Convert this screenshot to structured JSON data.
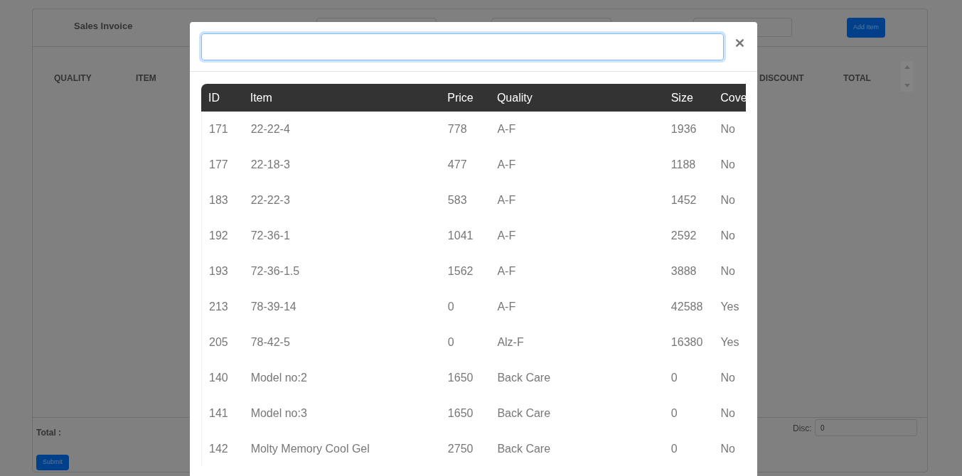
{
  "invoice": {
    "title": "Sales Invoice",
    "add_button": "Add Item",
    "columns": [
      "QUALITY",
      "ITEM",
      "DISCOUNT",
      "TOTAL"
    ],
    "total_label": "Total :",
    "disc_label": "Disc:",
    "disc_value": "0",
    "submit": "Submit"
  },
  "modal": {
    "columns": [
      "ID",
      "Item",
      "Price",
      "Quality",
      "Size",
      "Cove"
    ],
    "rows": [
      [
        "171",
        "22-22-4",
        "778",
        "A-F",
        "1936",
        "No"
      ],
      [
        "177",
        "22-18-3",
        "477",
        "A-F",
        "1188",
        "No"
      ],
      [
        "183",
        "22-22-3",
        "583",
        "A-F",
        "1452",
        "No"
      ],
      [
        "192",
        "72-36-1",
        "1041",
        "A-F",
        "2592",
        "No"
      ],
      [
        "193",
        "72-36-1.5",
        "1562",
        "A-F",
        "3888",
        "No"
      ],
      [
        "213",
        "78-39-14",
        "0",
        "A-F",
        "42588",
        "Yes"
      ],
      [
        "205",
        "78-42-5",
        "0",
        "Alz-F",
        "16380",
        "Yes"
      ],
      [
        "140",
        "Model no:2",
        "1650",
        "Back Care",
        "0",
        "No"
      ],
      [
        "141",
        "Model no:3",
        "1650",
        "Back Care",
        "0",
        "No"
      ],
      [
        "142",
        "Molty Memory Cool Gel",
        "2750",
        "Back Care",
        "0",
        "No"
      ]
    ]
  }
}
